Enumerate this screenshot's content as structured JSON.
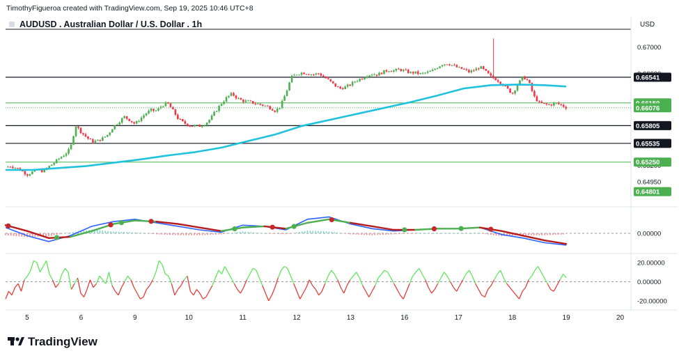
{
  "header": {
    "attribution": "TimothyFigueroa created with TradingView.com, Sep 19, 2025 10:46 UTC+8",
    "symbol_title": "AUDUSD . Australian Dollar / U.S. Dollar . 1h"
  },
  "brand": {
    "logo_text": "TradingView",
    "logo_icon": "tradingview-logo-icon"
  },
  "colors": {
    "up": "#4caf50",
    "down": "#f23645",
    "ma": "#1ec2dc",
    "macd_line": "#2962ff",
    "macd_signal": "#b71c1c",
    "osc_up": "#5ce65c",
    "osc_down": "#e53935",
    "hline_black": "#131722",
    "hline_green": "#4caf50",
    "dot_green": "#4caf50",
    "dot_red": "#c62828"
  },
  "chart_data": [
    {
      "type": "candlestick",
      "currency": "USD",
      "price_scale_labels": [
        "0.67000",
        "0.66600",
        "0.65200",
        "0.64950"
      ],
      "ylim": [
        0.6459,
        0.6725
      ],
      "x_ticks": [
        {
          "label": "5",
          "x": 0.4
        },
        {
          "label": "6",
          "x": 1.4
        },
        {
          "label": "9",
          "x": 2.4
        },
        {
          "label": "10",
          "x": 3.4
        },
        {
          "label": "11",
          "x": 4.4
        },
        {
          "label": "12",
          "x": 5.4
        },
        {
          "label": "13",
          "x": 6.4
        },
        {
          "label": "16",
          "x": 7.4
        },
        {
          "label": "17",
          "x": 8.4
        },
        {
          "label": "18",
          "x": 9.4
        },
        {
          "label": "19",
          "x": 10.4
        },
        {
          "label": "20",
          "x": 11.4
        }
      ],
      "x_range": [
        0,
        11.6
      ],
      "horizontal_levels": [
        {
          "value": 0.66541,
          "label": "0.66541",
          "style": "black"
        },
        {
          "value": 0.6615,
          "label": "0.66150",
          "style": "green"
        },
        {
          "value": 0.65805,
          "label": "0.65805",
          "style": "black"
        },
        {
          "value": 0.65535,
          "label": "0.65535",
          "style": "black"
        },
        {
          "value": 0.6525,
          "label": "0.65250",
          "style": "green"
        }
      ],
      "last_price": {
        "value": 0.66076,
        "label": "0.66076"
      },
      "lower_marker": {
        "value": 0.64801,
        "label": "0.64801"
      },
      "price_path": [
        [
          0.0,
          0.6517
        ],
        [
          0.1,
          0.6519
        ],
        [
          0.2,
          0.6516
        ],
        [
          0.3,
          0.6512
        ],
        [
          0.4,
          0.6506
        ],
        [
          0.5,
          0.651
        ],
        [
          0.6,
          0.6513
        ],
        [
          0.7,
          0.6511
        ],
        [
          0.8,
          0.6518
        ],
        [
          0.9,
          0.6524
        ],
        [
          1.0,
          0.6531
        ],
        [
          1.1,
          0.6537
        ],
        [
          1.2,
          0.6545
        ],
        [
          1.3,
          0.6581
        ],
        [
          1.4,
          0.6571
        ],
        [
          1.5,
          0.6563
        ],
        [
          1.6,
          0.6556
        ],
        [
          1.7,
          0.6557
        ],
        [
          1.8,
          0.6561
        ],
        [
          1.9,
          0.6567
        ],
        [
          2.0,
          0.6579
        ],
        [
          2.1,
          0.6586
        ],
        [
          2.2,
          0.6594
        ],
        [
          2.3,
          0.6589
        ],
        [
          2.4,
          0.6583
        ],
        [
          2.5,
          0.6591
        ],
        [
          2.6,
          0.6599
        ],
        [
          2.7,
          0.6604
        ],
        [
          2.8,
          0.6603
        ],
        [
          2.9,
          0.6611
        ],
        [
          3.0,
          0.6615
        ],
        [
          3.1,
          0.6604
        ],
        [
          3.2,
          0.6591
        ],
        [
          3.3,
          0.6585
        ],
        [
          3.4,
          0.6581
        ],
        [
          3.5,
          0.658
        ],
        [
          3.6,
          0.658
        ],
        [
          3.7,
          0.6583
        ],
        [
          3.8,
          0.6591
        ],
        [
          3.9,
          0.6603
        ],
        [
          4.0,
          0.6614
        ],
        [
          4.1,
          0.6623
        ],
        [
          4.2,
          0.6629
        ],
        [
          4.3,
          0.6622
        ],
        [
          4.4,
          0.6618
        ],
        [
          4.5,
          0.6617
        ],
        [
          4.6,
          0.6615
        ],
        [
          4.7,
          0.6613
        ],
        [
          4.8,
          0.6611
        ],
        [
          4.9,
          0.6608
        ],
        [
          5.0,
          0.6603
        ],
        [
          5.1,
          0.661
        ],
        [
          5.2,
          0.663
        ],
        [
          5.3,
          0.6654
        ],
        [
          5.4,
          0.6659
        ],
        [
          5.5,
          0.6661
        ],
        [
          5.6,
          0.666
        ],
        [
          5.7,
          0.6658
        ],
        [
          5.8,
          0.666
        ],
        [
          5.9,
          0.6655
        ],
        [
          6.0,
          0.6649
        ],
        [
          6.1,
          0.6642
        ],
        [
          6.2,
          0.6637
        ],
        [
          6.3,
          0.6639
        ],
        [
          6.4,
          0.6643
        ],
        [
          6.5,
          0.6649
        ],
        [
          6.6,
          0.6652
        ],
        [
          6.7,
          0.6657
        ],
        [
          6.8,
          0.6659
        ],
        [
          6.9,
          0.6658
        ],
        [
          7.0,
          0.6662
        ],
        [
          7.1,
          0.6665
        ],
        [
          7.2,
          0.6664
        ],
        [
          7.3,
          0.6666
        ],
        [
          7.4,
          0.6664
        ],
        [
          7.5,
          0.6661
        ],
        [
          7.6,
          0.6661
        ],
        [
          7.7,
          0.6659
        ],
        [
          7.8,
          0.6661
        ],
        [
          7.9,
          0.6663
        ],
        [
          8.0,
          0.6669
        ],
        [
          8.1,
          0.6674
        ],
        [
          8.2,
          0.6675
        ],
        [
          8.3,
          0.6672
        ],
        [
          8.4,
          0.6668
        ],
        [
          8.5,
          0.6666
        ],
        [
          8.6,
          0.6662
        ],
        [
          8.7,
          0.6665
        ],
        [
          8.8,
          0.667
        ],
        [
          8.9,
          0.6663
        ],
        [
          9.0,
          0.6655
        ],
        [
          9.1,
          0.6651
        ],
        [
          9.2,
          0.6645
        ],
        [
          9.3,
          0.6637
        ],
        [
          9.4,
          0.6629
        ],
        [
          9.5,
          0.6643
        ],
        [
          9.6,
          0.6655
        ],
        [
          9.7,
          0.6648
        ],
        [
          9.8,
          0.6625
        ],
        [
          9.9,
          0.6615
        ],
        [
          10.0,
          0.6613
        ],
        [
          10.1,
          0.6612
        ],
        [
          10.2,
          0.6615
        ],
        [
          10.3,
          0.6612
        ],
        [
          10.4,
          0.6608
        ]
      ],
      "sma": [
        [
          0.0,
          0.6513
        ],
        [
          0.5,
          0.6513
        ],
        [
          1.0,
          0.6516
        ],
        [
          1.5,
          0.6519
        ],
        [
          2.0,
          0.6524
        ],
        [
          2.5,
          0.6529
        ],
        [
          3.0,
          0.6535
        ],
        [
          3.5,
          0.654
        ],
        [
          4.0,
          0.6547
        ],
        [
          4.5,
          0.6557
        ],
        [
          5.0,
          0.6567
        ],
        [
          5.5,
          0.658
        ],
        [
          6.0,
          0.6589
        ],
        [
          6.5,
          0.6598
        ],
        [
          7.0,
          0.6607
        ],
        [
          7.5,
          0.6616
        ],
        [
          8.0,
          0.6626
        ],
        [
          8.5,
          0.6637
        ],
        [
          9.0,
          0.6642
        ],
        [
          9.5,
          0.6643
        ],
        [
          10.0,
          0.6642
        ],
        [
          10.4,
          0.664
        ]
      ]
    },
    {
      "type": "line",
      "panel": "macd",
      "zero_label": "0.00000",
      "ylim": [
        -0.0016,
        0.0022
      ],
      "series": [
        {
          "role": "macd",
          "points": [
            [
              0.0,
              0.0005
            ],
            [
              0.4,
              -0.0002
            ],
            [
              0.8,
              -0.0007
            ],
            [
              1.2,
              -0.0002
            ],
            [
              1.6,
              0.0006
            ],
            [
              2.0,
              0.001
            ],
            [
              2.4,
              0.0012
            ],
            [
              2.8,
              0.0009
            ],
            [
              3.2,
              0.0006
            ],
            [
              3.6,
              0.0003
            ],
            [
              4.0,
              0.0001
            ],
            [
              4.4,
              0.0007
            ],
            [
              4.8,
              0.0006
            ],
            [
              5.2,
              0.0003
            ],
            [
              5.6,
              0.0012
            ],
            [
              6.0,
              0.0014
            ],
            [
              6.4,
              0.0008
            ],
            [
              6.8,
              0.0004
            ],
            [
              7.2,
              0.0002
            ],
            [
              7.6,
              0.0003
            ],
            [
              8.0,
              0.0004
            ],
            [
              8.4,
              0.0004
            ],
            [
              8.8,
              0.0005
            ],
            [
              9.2,
              -0.0001
            ],
            [
              9.6,
              -0.0004
            ],
            [
              10.0,
              -0.0008
            ],
            [
              10.4,
              -0.001
            ]
          ]
        },
        {
          "role": "signal",
          "points": [
            [
              0.0,
              0.0007
            ],
            [
              0.4,
              0.0002
            ],
            [
              0.8,
              -0.0004
            ],
            [
              1.2,
              -0.0003
            ],
            [
              1.6,
              0.0002
            ],
            [
              2.0,
              0.0008
            ],
            [
              2.4,
              0.0011
            ],
            [
              2.8,
              0.001
            ],
            [
              3.2,
              0.0008
            ],
            [
              3.6,
              0.0005
            ],
            [
              4.0,
              0.0002
            ],
            [
              4.4,
              0.0005
            ],
            [
              4.8,
              0.0006
            ],
            [
              5.2,
              0.0004
            ],
            [
              5.6,
              0.0009
            ],
            [
              6.0,
              0.0012
            ],
            [
              6.4,
              0.0009
            ],
            [
              6.8,
              0.0006
            ],
            [
              7.2,
              0.0003
            ],
            [
              7.6,
              0.0003
            ],
            [
              8.0,
              0.0004
            ],
            [
              8.4,
              0.0004
            ],
            [
              8.8,
              0.0005
            ],
            [
              9.2,
              0.0002
            ],
            [
              9.6,
              -0.0002
            ],
            [
              10.0,
              -0.0006
            ],
            [
              10.4,
              -0.0009
            ]
          ]
        }
      ],
      "crossovers": [
        {
          "x": 0.05,
          "color": "red"
        },
        {
          "x": 0.95,
          "color": "green"
        },
        {
          "x": 1.95,
          "color": "red"
        },
        {
          "x": 2.15,
          "color": "green"
        },
        {
          "x": 2.7,
          "color": "red"
        },
        {
          "x": 4.25,
          "color": "green"
        },
        {
          "x": 4.95,
          "color": "red"
        },
        {
          "x": 5.35,
          "color": "green"
        },
        {
          "x": 6.05,
          "color": "red"
        },
        {
          "x": 7.4,
          "color": "green"
        },
        {
          "x": 7.95,
          "color": "red"
        },
        {
          "x": 8.45,
          "color": "green"
        },
        {
          "x": 9.0,
          "color": "red"
        }
      ]
    },
    {
      "type": "line",
      "panel": "oscillator",
      "scale_labels": [
        "20.00000",
        "0.00000",
        "-20.00000"
      ],
      "ylim": [
        -28,
        28
      ],
      "values": [
        -18,
        -10,
        -14,
        -6,
        -2,
        -10,
        2,
        6,
        12,
        22,
        20,
        10,
        16,
        22,
        8,
        2,
        -6,
        -2,
        8,
        14,
        10,
        -8,
        -2,
        4,
        -12,
        -16,
        -8,
        2,
        -6,
        -2,
        6,
        2,
        -2,
        10,
        -4,
        -10,
        -14,
        -6,
        0,
        6,
        2,
        -6,
        -12,
        -18,
        -16,
        -8,
        -4,
        2,
        10,
        22,
        18,
        8,
        6,
        -2,
        -14,
        -8,
        -4,
        2,
        6,
        -10,
        -14,
        -8,
        -12,
        -18,
        -16,
        -10,
        -4,
        4,
        12,
        8,
        16,
        10,
        4,
        -2,
        -8,
        -12,
        -6,
        2,
        8,
        14,
        12,
        4,
        -4,
        -12,
        -20,
        -14,
        -6,
        4,
        12,
        16,
        14,
        6,
        -2,
        -10,
        -18,
        -12,
        -6,
        2,
        -4,
        -8,
        -14,
        -10,
        -2,
        6,
        12,
        8,
        2,
        -6,
        -12,
        -4,
        2,
        6,
        10,
        4,
        -4,
        -10,
        -16,
        -10,
        -4,
        4,
        8,
        12,
        10,
        4,
        -2,
        -8,
        -14,
        -18,
        -10,
        -2,
        6,
        10,
        14,
        8,
        2,
        -6,
        -12,
        -8,
        -2,
        4,
        10,
        6,
        0,
        -6,
        -10,
        -4,
        2,
        8,
        12,
        6,
        -2,
        -8,
        -14,
        -16,
        -8,
        -4,
        2,
        8,
        12,
        4,
        -2,
        -6,
        -10,
        -14,
        -18,
        -10,
        -6,
        2,
        6,
        12,
        16,
        10,
        4,
        -2,
        -8,
        -10,
        -4,
        2,
        8,
        4
      ]
    }
  ]
}
